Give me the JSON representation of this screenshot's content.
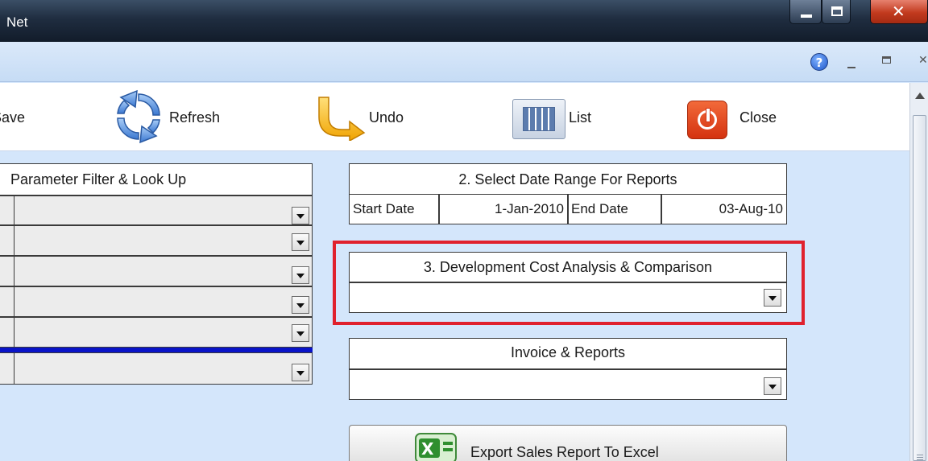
{
  "window": {
    "title": "Net",
    "controls": {
      "minimize": "minimize",
      "maximize": "maximize",
      "close": "close"
    }
  },
  "child_window": {
    "help_glyph": "?"
  },
  "toolbar": {
    "save_label": "Save",
    "refresh_label": "Refresh",
    "undo_label": "Undo",
    "list_label": "List",
    "close_label": "Close"
  },
  "parameter_filter": {
    "header": "Parameter Filter & Look Up",
    "rows": [
      {
        "value": ""
      },
      {
        "value": ""
      },
      {
        "value": ""
      },
      {
        "value": ""
      },
      {
        "value": ""
      },
      {
        "value": ""
      }
    ]
  },
  "date_range": {
    "header": "2. Select Date Range For  Reports",
    "start_label": "Start Date",
    "start_value": "1-Jan-2010",
    "end_label": "End Date",
    "end_value": "03-Aug-10"
  },
  "cost_analysis": {
    "header": "3. Development Cost Analysis & Comparison",
    "selected": ""
  },
  "invoice_reports": {
    "header": "Invoice & Reports",
    "selected": ""
  },
  "export": {
    "label": "Export Sales Report To Excel"
  },
  "colors": {
    "background": "#d4e6fb",
    "highlight": "#e0212d",
    "selection_line": "#0a14c8"
  },
  "icons": [
    "refresh-icon",
    "undo-icon",
    "list-icon",
    "close-icon",
    "excel-icon",
    "help-icon"
  ]
}
